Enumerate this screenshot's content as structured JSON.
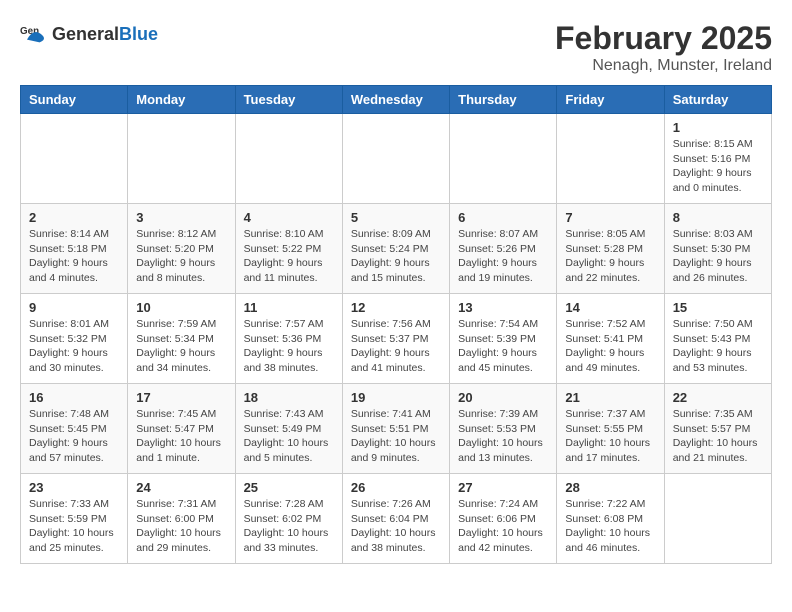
{
  "header": {
    "logo_general": "General",
    "logo_blue": "Blue",
    "title": "February 2025",
    "subtitle": "Nenagh, Munster, Ireland"
  },
  "calendar": {
    "days_of_week": [
      "Sunday",
      "Monday",
      "Tuesday",
      "Wednesday",
      "Thursday",
      "Friday",
      "Saturday"
    ],
    "weeks": [
      [
        {
          "day": "",
          "info": ""
        },
        {
          "day": "",
          "info": ""
        },
        {
          "day": "",
          "info": ""
        },
        {
          "day": "",
          "info": ""
        },
        {
          "day": "",
          "info": ""
        },
        {
          "day": "",
          "info": ""
        },
        {
          "day": "1",
          "info": "Sunrise: 8:15 AM\nSunset: 5:16 PM\nDaylight: 9 hours\nand 0 minutes."
        }
      ],
      [
        {
          "day": "2",
          "info": "Sunrise: 8:14 AM\nSunset: 5:18 PM\nDaylight: 9 hours\nand 4 minutes."
        },
        {
          "day": "3",
          "info": "Sunrise: 8:12 AM\nSunset: 5:20 PM\nDaylight: 9 hours\nand 8 minutes."
        },
        {
          "day": "4",
          "info": "Sunrise: 8:10 AM\nSunset: 5:22 PM\nDaylight: 9 hours\nand 11 minutes."
        },
        {
          "day": "5",
          "info": "Sunrise: 8:09 AM\nSunset: 5:24 PM\nDaylight: 9 hours\nand 15 minutes."
        },
        {
          "day": "6",
          "info": "Sunrise: 8:07 AM\nSunset: 5:26 PM\nDaylight: 9 hours\nand 19 minutes."
        },
        {
          "day": "7",
          "info": "Sunrise: 8:05 AM\nSunset: 5:28 PM\nDaylight: 9 hours\nand 22 minutes."
        },
        {
          "day": "8",
          "info": "Sunrise: 8:03 AM\nSunset: 5:30 PM\nDaylight: 9 hours\nand 26 minutes."
        }
      ],
      [
        {
          "day": "9",
          "info": "Sunrise: 8:01 AM\nSunset: 5:32 PM\nDaylight: 9 hours\nand 30 minutes."
        },
        {
          "day": "10",
          "info": "Sunrise: 7:59 AM\nSunset: 5:34 PM\nDaylight: 9 hours\nand 34 minutes."
        },
        {
          "day": "11",
          "info": "Sunrise: 7:57 AM\nSunset: 5:36 PM\nDaylight: 9 hours\nand 38 minutes."
        },
        {
          "day": "12",
          "info": "Sunrise: 7:56 AM\nSunset: 5:37 PM\nDaylight: 9 hours\nand 41 minutes."
        },
        {
          "day": "13",
          "info": "Sunrise: 7:54 AM\nSunset: 5:39 PM\nDaylight: 9 hours\nand 45 minutes."
        },
        {
          "day": "14",
          "info": "Sunrise: 7:52 AM\nSunset: 5:41 PM\nDaylight: 9 hours\nand 49 minutes."
        },
        {
          "day": "15",
          "info": "Sunrise: 7:50 AM\nSunset: 5:43 PM\nDaylight: 9 hours\nand 53 minutes."
        }
      ],
      [
        {
          "day": "16",
          "info": "Sunrise: 7:48 AM\nSunset: 5:45 PM\nDaylight: 9 hours\nand 57 minutes."
        },
        {
          "day": "17",
          "info": "Sunrise: 7:45 AM\nSunset: 5:47 PM\nDaylight: 10 hours\nand 1 minute."
        },
        {
          "day": "18",
          "info": "Sunrise: 7:43 AM\nSunset: 5:49 PM\nDaylight: 10 hours\nand 5 minutes."
        },
        {
          "day": "19",
          "info": "Sunrise: 7:41 AM\nSunset: 5:51 PM\nDaylight: 10 hours\nand 9 minutes."
        },
        {
          "day": "20",
          "info": "Sunrise: 7:39 AM\nSunset: 5:53 PM\nDaylight: 10 hours\nand 13 minutes."
        },
        {
          "day": "21",
          "info": "Sunrise: 7:37 AM\nSunset: 5:55 PM\nDaylight: 10 hours\nand 17 minutes."
        },
        {
          "day": "22",
          "info": "Sunrise: 7:35 AM\nSunset: 5:57 PM\nDaylight: 10 hours\nand 21 minutes."
        }
      ],
      [
        {
          "day": "23",
          "info": "Sunrise: 7:33 AM\nSunset: 5:59 PM\nDaylight: 10 hours\nand 25 minutes."
        },
        {
          "day": "24",
          "info": "Sunrise: 7:31 AM\nSunset: 6:00 PM\nDaylight: 10 hours\nand 29 minutes."
        },
        {
          "day": "25",
          "info": "Sunrise: 7:28 AM\nSunset: 6:02 PM\nDaylight: 10 hours\nand 33 minutes."
        },
        {
          "day": "26",
          "info": "Sunrise: 7:26 AM\nSunset: 6:04 PM\nDaylight: 10 hours\nand 38 minutes."
        },
        {
          "day": "27",
          "info": "Sunrise: 7:24 AM\nSunset: 6:06 PM\nDaylight: 10 hours\nand 42 minutes."
        },
        {
          "day": "28",
          "info": "Sunrise: 7:22 AM\nSunset: 6:08 PM\nDaylight: 10 hours\nand 46 minutes."
        },
        {
          "day": "",
          "info": ""
        }
      ]
    ]
  }
}
